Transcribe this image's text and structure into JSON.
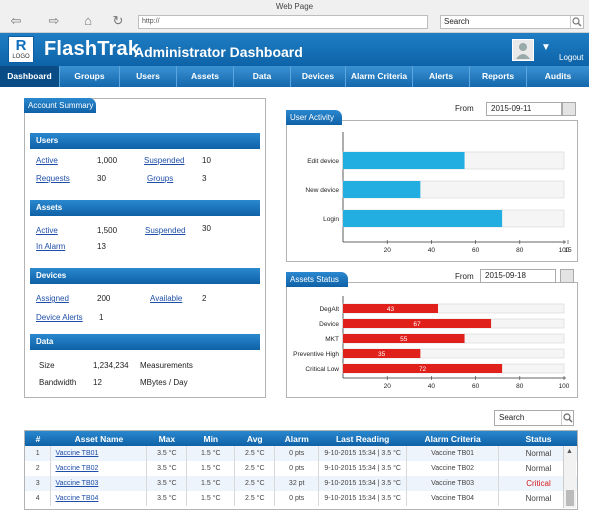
{
  "browser": {
    "window_title": "Web Page",
    "url": "http://",
    "search_placeholder": "Search"
  },
  "header": {
    "logo_letter": "R",
    "logo_text": "LOGO",
    "brand": "FlashTrak",
    "subtitle": "Administrator Dashboard",
    "logout": "Logout"
  },
  "nav": [
    "Dashboard",
    "Groups",
    "Users",
    "Assets",
    "Data",
    "Devices",
    "Alarm Criteria",
    "Alerts",
    "Reports",
    "Audits"
  ],
  "account_summary": {
    "title": "Account Summary",
    "users": {
      "title": "Users",
      "active_label": "Active",
      "active_value": "1,000",
      "suspended_label": "Suspended",
      "suspended_value": "10",
      "requests_label": "Requests",
      "requests_value": "30",
      "groups_label": "Groups",
      "groups_value": "3"
    },
    "assets": {
      "title": "Assets",
      "active_label": "Active",
      "active_value": "1,500",
      "suspended_label": "Suspended",
      "suspended_value": "30",
      "inalarm_label": "In Alarm",
      "inalarm_value": "13"
    },
    "devices": {
      "title": "Devices",
      "assigned_label": "Assigned",
      "assigned_value": "200",
      "available_label": "Available",
      "available_value": "2",
      "alerts_label": "Device Alerts",
      "alerts_value": "1"
    },
    "data": {
      "title": "Data",
      "size_label": "Size",
      "size_value": "1,234,234",
      "size_unit": "Measurements",
      "bandwidth_label": "Bandwidth",
      "bandwidth_value": "12",
      "bandwidth_unit": "MBytes / Day"
    }
  },
  "user_activity": {
    "title": "User Activity",
    "from_label": "From",
    "from_date": "2015-09-11"
  },
  "assets_status": {
    "title": "Assets Status",
    "from_label": "From",
    "from_date": "2015-09-18"
  },
  "chart_data": [
    {
      "type": "bar",
      "orientation": "horizontal",
      "categories": [
        "Edit device",
        "New device",
        "Login"
      ],
      "values": [
        55,
        35,
        72
      ],
      "xlim": [
        0,
        100
      ],
      "xticks": [
        "20",
        "40",
        "60",
        "80",
        "100",
        "15"
      ],
      "color": "#22aee0"
    },
    {
      "type": "bar",
      "orientation": "horizontal",
      "categories": [
        "DegAlt",
        "Device",
        "MKT",
        "Preventive High",
        "Critical Low"
      ],
      "values": [
        43,
        67,
        55,
        35,
        72
      ],
      "data_labels": [
        "43",
        "67",
        "55",
        "35",
        "72"
      ],
      "xlim": [
        0,
        100
      ],
      "xticks": [
        "20",
        "40",
        "60",
        "80",
        "100"
      ],
      "color": "#e0201b"
    }
  ],
  "table": {
    "search_placeholder": "Search",
    "columns": [
      "#",
      "Asset Name",
      "Max",
      "Min",
      "Avg",
      "Alarm",
      "Last Reading",
      "Alarm Criteria",
      "Status"
    ],
    "rows": [
      [
        "1",
        "Vaccine TB01",
        "3.5 °C",
        "1.5 °C",
        "2.5 °C",
        "0 pts",
        "9-10-2015 15:34 | 3.5 °C",
        "Vaccine TB01",
        "Normal"
      ],
      [
        "2",
        "Vaccine TB02",
        "3.5 °C",
        "1.5 °C",
        "2.5 °C",
        "0 pts",
        "9-10-2015 15:34 | 3.5 °C",
        "Vaccine TB02",
        "Normal"
      ],
      [
        "3",
        "Vaccine TB03",
        "3.5 °C",
        "1.5 °C",
        "2.5 °C",
        "32 pt",
        "9-10-2015 15:34 | 3.5 °C",
        "Vaccine TB03",
        "Critical"
      ],
      [
        "4",
        "Vaccine TB04",
        "3.5 °C",
        "1.5 °C",
        "2.5 °C",
        "0 pts",
        "9-10-2015 15:34 | 3.5 °C",
        "Vaccine TB04",
        "Normal"
      ]
    ],
    "critical_color": "#d11a1a"
  }
}
